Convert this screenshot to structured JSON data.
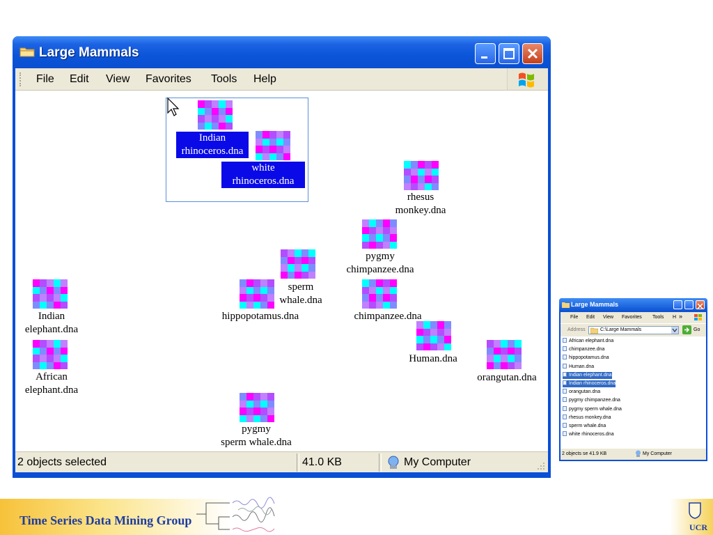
{
  "window": {
    "title": "Large Mammals",
    "menu": [
      "File",
      "Edit",
      "View",
      "Favorites",
      "Tools",
      "Help"
    ],
    "status": {
      "selection": "2 objects selected",
      "size": "41.0 KB",
      "location": "My Computer"
    }
  },
  "colors": {
    "magenta": "#ff00ff",
    "cyan": "#00ffff",
    "violet": "#b34dff",
    "periwinkle": "#7f8cff",
    "lilac": "#c080ff",
    "selection": "#0a0ae8"
  },
  "files": [
    {
      "id": "indian-rhinoceros",
      "line1": "Indian",
      "line2": "rhinoceros.dna",
      "selected": true
    },
    {
      "id": "white-rhinoceros",
      "line1": "white",
      "line2": "rhinoceros.dna",
      "selected": true
    },
    {
      "id": "rhesus-monkey",
      "line1": "rhesus",
      "line2": "monkey.dna",
      "selected": false
    },
    {
      "id": "pygmy-chimpanzee",
      "line1": "pygmy",
      "line2": "chimpanzee.dna",
      "selected": false
    },
    {
      "id": "sperm-whale",
      "line1": "sperm",
      "line2": "whale.dna",
      "selected": false
    },
    {
      "id": "indian-elephant",
      "line1": "Indian",
      "line2": "elephant.dna",
      "selected": false
    },
    {
      "id": "hippopotamus",
      "line1": "hippopotamus.dna",
      "line2": "",
      "selected": false
    },
    {
      "id": "chimpanzee",
      "line1": "chimpanzee.dna",
      "line2": "",
      "selected": false
    },
    {
      "id": "human",
      "line1": "Human.dna",
      "line2": "",
      "selected": false
    },
    {
      "id": "orangutan",
      "line1": "orangutan.dna",
      "line2": "",
      "selected": false
    },
    {
      "id": "african-elephant",
      "line1": "African",
      "line2": "elephant.dna",
      "selected": false
    },
    {
      "id": "pygmy-sperm-whale",
      "line1": "pygmy",
      "line2": "sperm whale.dna",
      "selected": false
    }
  ],
  "small_window": {
    "title": "Large Mammals",
    "menu": [
      "File",
      "Edit",
      "View",
      "Favorites",
      "Tools",
      "H",
      "»"
    ],
    "address_label": "Address",
    "address": "C:\\Large Mammals",
    "go": "Go",
    "list": [
      "African elephant.dna",
      "chimpanzee.dna",
      "hippopotamus.dna",
      "Human.dna",
      "Indian elephant.dna",
      "Indian rhinoceros.dna",
      "orangutan.dna",
      "pygmy chimpanzee.dna",
      "pygmy sperm whale.dna",
      "rhesus monkey.dna",
      "sperm whale.dna",
      "white rhinoceros.dna"
    ],
    "selected_indices": [
      4,
      5
    ],
    "status_left": "2 objects se 41.9 KB",
    "status_right": "My Computer"
  },
  "footer": {
    "group_name": "Time Series Data Mining Group",
    "logo_text": "UCR"
  }
}
